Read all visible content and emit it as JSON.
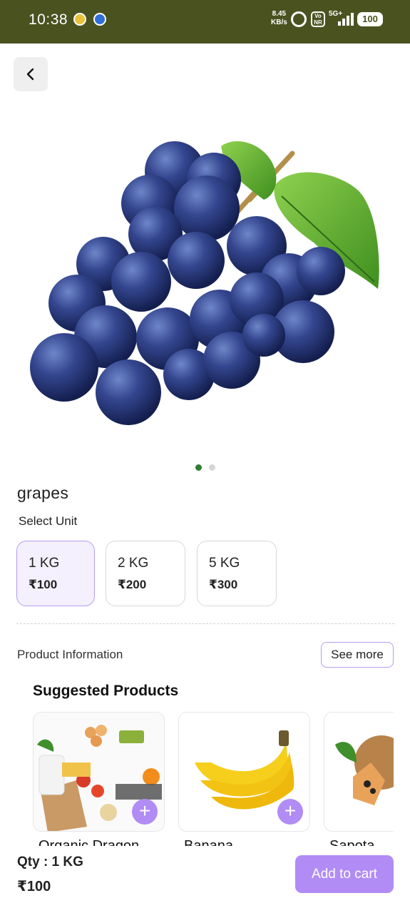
{
  "status_bar": {
    "time": "10:38",
    "net_speed_value": "8.45",
    "net_speed_unit": "KB/s",
    "volte": "Vo NR",
    "network": "5G+",
    "battery": "100"
  },
  "product": {
    "name": "grapes",
    "image_icon": "grapes-image",
    "carousel_dots": 2,
    "active_dot": 0
  },
  "units": {
    "label": "Select Unit",
    "options": [
      {
        "name": "1 KG",
        "price": "₹100",
        "selected": true
      },
      {
        "name": "2 KG",
        "price": "₹200",
        "selected": false
      },
      {
        "name": "5 KG",
        "price": "₹300",
        "selected": false
      }
    ]
  },
  "product_info": {
    "label": "Product Information",
    "see_more": "See more"
  },
  "suggested": {
    "title": "Suggested Products",
    "items": [
      {
        "name": "Organic Dragon",
        "image_icon": "groceries-image"
      },
      {
        "name": "Banana",
        "image_icon": "banana-image"
      },
      {
        "name": "Sapota",
        "image_icon": "sapota-image"
      }
    ]
  },
  "cart": {
    "qty": "Qty : 1 KG",
    "total": "₹100",
    "add_button": "Add to cart"
  },
  "colors": {
    "status_bar": "#4a5320",
    "accent": "#b18cf5",
    "selected_card_bg": "#f4f0fe",
    "active_dot": "#2e7d32"
  }
}
